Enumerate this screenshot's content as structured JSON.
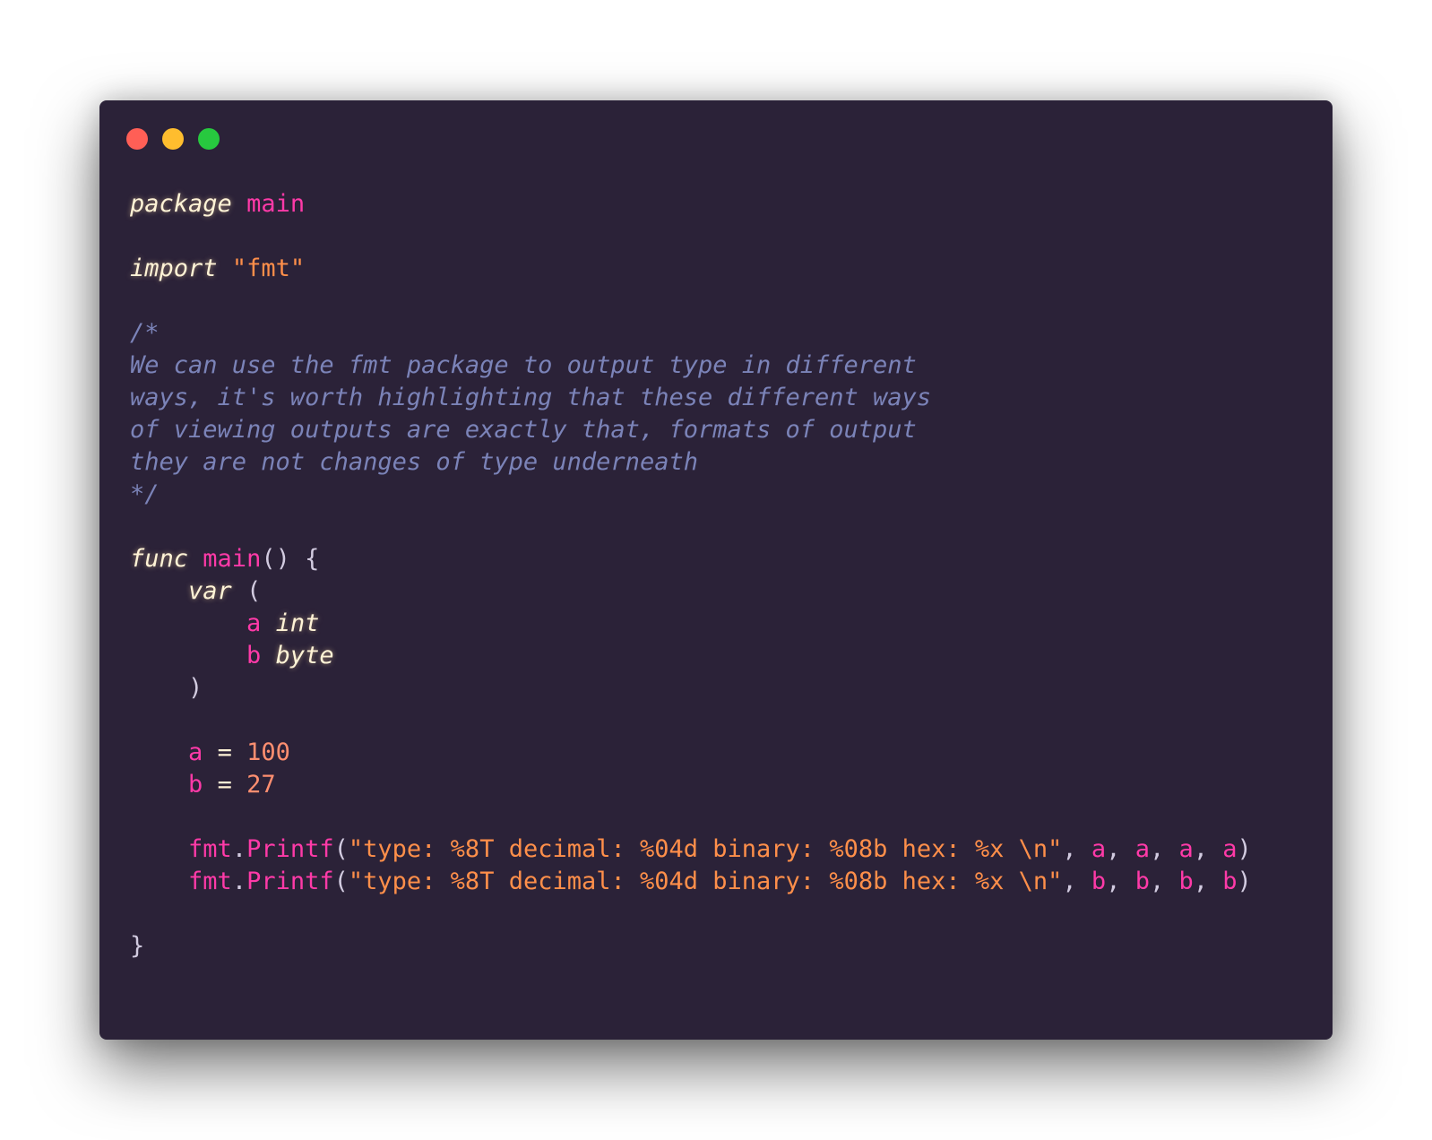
{
  "window": {
    "buttons": {
      "close_color": "#ff5f56",
      "minimize_color": "#ffbd2e",
      "maximize_color": "#27c93f"
    },
    "background": "#2b2238"
  },
  "code": {
    "language": "go",
    "lines": {
      "l1": {
        "kw": "package",
        "name": "main"
      },
      "l3": {
        "kw": "import",
        "str": "\"fmt\""
      },
      "l5": {
        "text": "/*"
      },
      "l6": {
        "text": "We can use the fmt package to output type in different"
      },
      "l7": {
        "text": "ways, it's worth highlighting that these different ways"
      },
      "l8": {
        "text": "of viewing outputs are exactly that, formats of output"
      },
      "l9": {
        "text": "they are not changes of type underneath"
      },
      "l10": {
        "text": "*/"
      },
      "l12": {
        "kw": "func",
        "name": "main",
        "punc": "() {"
      },
      "l13": {
        "kw": "var",
        "punc": "("
      },
      "l14": {
        "name": "a",
        "type": "int"
      },
      "l15": {
        "name": "b",
        "type": "byte"
      },
      "l16": {
        "punc": ")"
      },
      "l18": {
        "name": "a",
        "op": "=",
        "num": "100"
      },
      "l19": {
        "name": "b",
        "op": "=",
        "num": "27"
      },
      "l21": {
        "pkg": "fmt",
        "fn": "Printf",
        "str": "\"type: %8T decimal: %04d binary: %08b hex: %x \\n\"",
        "arg": "a"
      },
      "l22": {
        "pkg": "fmt",
        "fn": "Printf",
        "str": "\"type: %8T decimal: %04d binary: %08b hex: %x \\n\"",
        "arg": "b"
      },
      "l24": {
        "punc": "}"
      }
    }
  }
}
